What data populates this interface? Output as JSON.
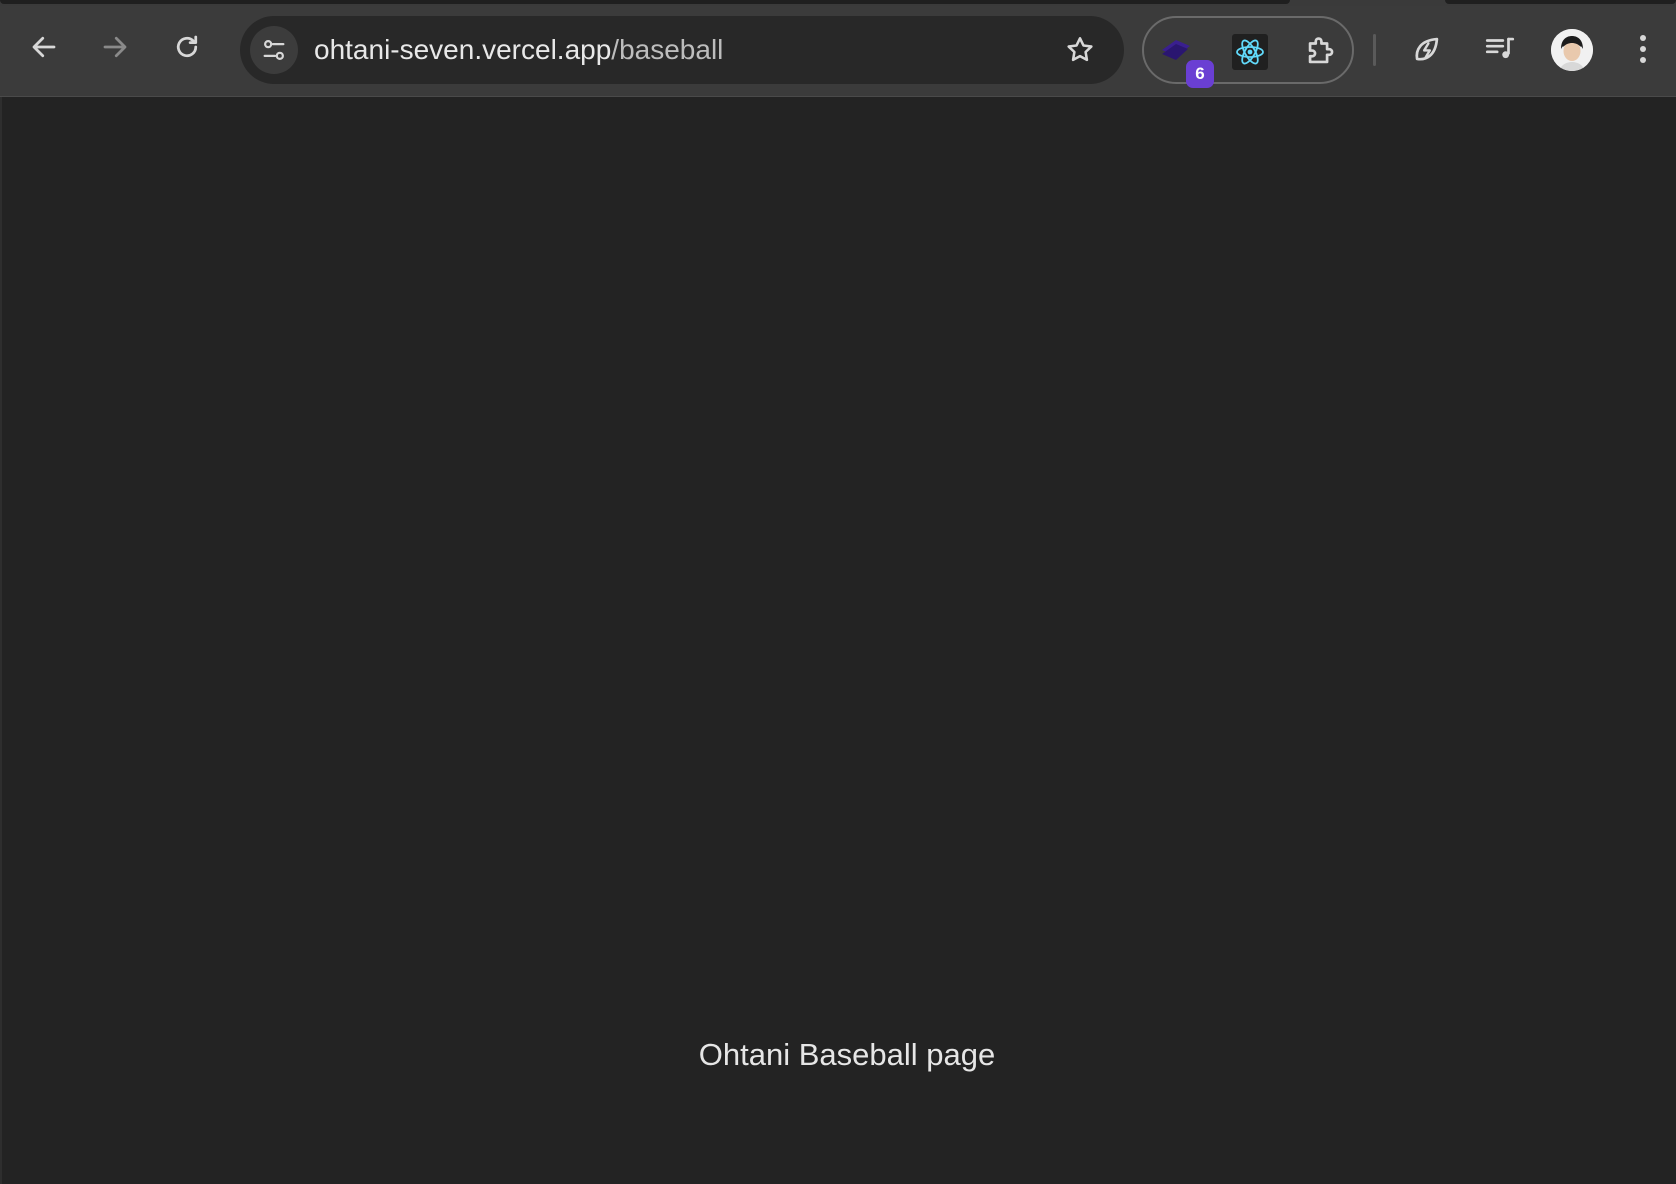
{
  "browser": {
    "url_host": "ohtani-seven.vercel.app",
    "url_path": "/baseball",
    "extensions": [
      {
        "name": "stacked-layers-extension-icon",
        "badge": "6",
        "badge_color": "#6a3fd3"
      },
      {
        "name": "react-devtools-icon"
      },
      {
        "name": "puzzle-extensions-icon"
      }
    ],
    "toolbar_icons": [
      "performance-leaf-icon",
      "media-playlist-icon",
      "avatar",
      "more-vert-icon"
    ]
  },
  "page": {
    "text": "Ohtani Baseball page",
    "background": "#232323"
  }
}
